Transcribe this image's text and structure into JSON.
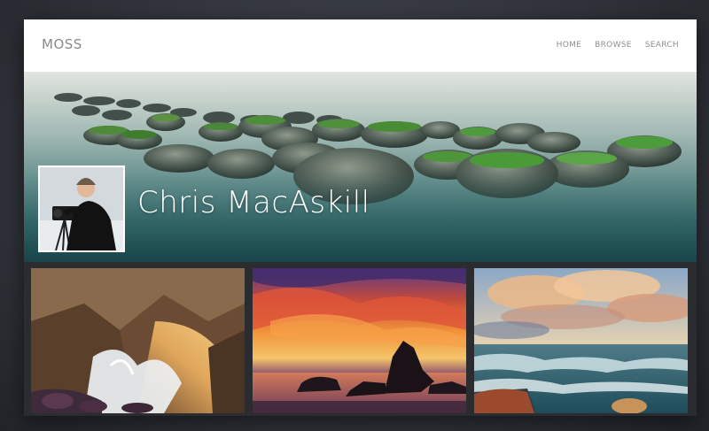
{
  "nav": {
    "logo": "MOSS",
    "links": [
      {
        "label": "HOME"
      },
      {
        "label": "BROWSE"
      },
      {
        "label": "SEARCH"
      }
    ]
  },
  "profile": {
    "name": "Chris MacAskill"
  },
  "gallery": {
    "photos": [
      {
        "subject": "sea cave with crashing wave"
      },
      {
        "subject": "sunset sea stack"
      },
      {
        "subject": "ocean waves under clouds"
      }
    ]
  },
  "colors": {
    "nav_bg": "#ffffff",
    "nav_text": "#8f8f8f",
    "window_bg": "#2b2c30",
    "name_text": "#ffffff"
  }
}
